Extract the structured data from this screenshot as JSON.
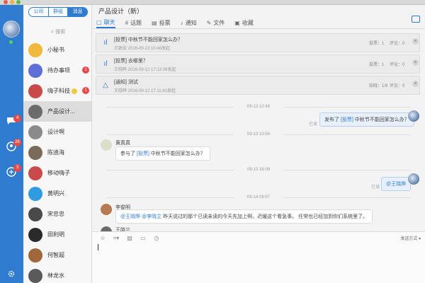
{
  "sidebar": {
    "badges": [
      "4",
      "26",
      "3"
    ]
  },
  "contacts": {
    "segments": [
      "公司",
      "群组",
      "消息"
    ],
    "search_placeholder": "搜索",
    "items": [
      {
        "name": "小秘书",
        "color": "#f0b93c",
        "badge": ""
      },
      {
        "name": "待办事项",
        "color": "#5b6fd6",
        "badge": "1"
      },
      {
        "name": "嗨子科技",
        "color": "#c94a4a",
        "badge": "1"
      },
      {
        "name": "产品设计...",
        "color": "#6b6b6b",
        "badge": ""
      },
      {
        "name": "设计啊",
        "color": "#8a8a8a",
        "badge": ""
      },
      {
        "name": "陈迪海",
        "color": "#7a6a5a",
        "badge": ""
      },
      {
        "name": "移动嗨子",
        "color": "#c94a4a",
        "badge": ""
      },
      {
        "name": "黄明兴",
        "color": "#2f9be0",
        "badge": ""
      },
      {
        "name": "宋忠忠",
        "color": "#4a4a4a",
        "badge": ""
      },
      {
        "name": "田利明",
        "color": "#2a2a2a",
        "badge": ""
      },
      {
        "name": "何智超",
        "color": "#a0683a",
        "badge": ""
      },
      {
        "name": "林龙水",
        "color": "#5a5a5a",
        "badge": ""
      }
    ]
  },
  "chat": {
    "title": "产品设计（新）",
    "tabs": [
      {
        "label": "聊天",
        "icon": "▢"
      },
      {
        "label": "话题",
        "icon": "#"
      },
      {
        "label": "投票",
        "icon": "▤"
      },
      {
        "label": "通知",
        "icon": "♪"
      },
      {
        "label": "文件",
        "icon": "✎"
      },
      {
        "label": "收藏",
        "icon": "▣"
      }
    ],
    "notices": [
      {
        "icon": "bar-chart-icon",
        "title": "[投票] 中秋节不能回家怎么办？",
        "meta": "王致宏  2016-09-13 10:48发起",
        "c1": "投票：1",
        "c2": "评论：0"
      },
      {
        "icon": "bar-chart-icon",
        "title": "[投票] 去哪里？",
        "meta": "王晓晔  2016-09-12 17:13:09发起",
        "c1": "投票：1",
        "c2": "评论：0"
      },
      {
        "icon": "bell-icon",
        "title": "[通知] 测试",
        "meta": "王晓晔  2016-09-12 17:11:42发起",
        "c1": "知晓：1/9",
        "c2": "评论：0"
      }
    ],
    "messages": {
      "time1": "09-13 10:48",
      "m1_text": "发布了",
      "m1_tag": "[投票]",
      "m1_body": "中秋节不能回家怎么办？",
      "m1_read": "已读",
      "time2": "09-13 10:54",
      "m2_sender": "黄真真",
      "m2_text": "参与了",
      "m2_tag": "[投票]",
      "m2_body": "中秋节不能回家怎么办？",
      "time3": "09-13 16:09",
      "m3_at": "@王晓晔",
      "m3_read": "已读",
      "time4": "09-14 09:57",
      "m4_sender": "李俊明",
      "m4_at": "@王晓晔 @李晓立",
      "m4_body": "昨天说过的那个已读未读的今天先加上啊，迟缓这个看急事。 任常也已经加到你们系统里了。",
      "m5_sender": "王晓兰"
    },
    "send_mode": "发送方式 ▾"
  }
}
